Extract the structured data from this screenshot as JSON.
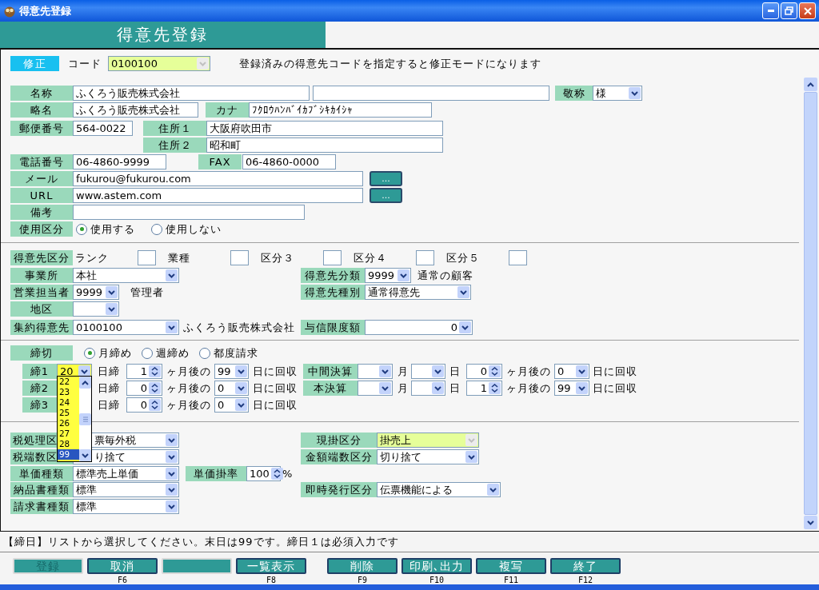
{
  "window": {
    "title": "得意先登録"
  },
  "header": {
    "title": "得意先登録"
  },
  "mode": {
    "badge": "修正",
    "code_label": "コード",
    "code": {
      "value": "0100100",
      "disabled": true
    },
    "hint": "登録済みの得意先コードを指定すると修正モードになります"
  },
  "basic": {
    "name": {
      "label": "名称",
      "value": "ふくろう販売株式会社"
    },
    "honorific": {
      "label": "敬称",
      "value": "様"
    },
    "short_name": {
      "label": "略名",
      "value": "ふくろう販売株式会社"
    },
    "kana": {
      "label": "カナ",
      "value": "ﾌｸﾛｳﾊﾝﾊﾞｲｶﾌﾞｼｷｶｲｼｬ"
    },
    "postal": {
      "label": "郵便番号",
      "value": "564-0022"
    },
    "address1": {
      "label": "住所１",
      "value": "大阪府吹田市"
    },
    "address2": {
      "label": "住所２",
      "value": "昭和町"
    },
    "phone": {
      "label": "電話番号",
      "value": "06-4860-9999"
    },
    "fax": {
      "label": "FAX",
      "value": "06-4860-0000"
    },
    "email": {
      "label": "メール",
      "value": "fukurou@fukurou.com",
      "button": "..."
    },
    "url": {
      "label": "URL",
      "value": "www.astem.com",
      "button": "..."
    },
    "note": {
      "label": "備考"
    },
    "usage": {
      "label": "使用区分",
      "options": [
        {
          "label": "使用する",
          "selected": true
        },
        {
          "label": "使用しない",
          "selected": false
        }
      ]
    }
  },
  "classification": {
    "label": "得意先区分",
    "slots": [
      "ランク",
      "業種",
      "区分３",
      "区分４",
      "区分５"
    ]
  },
  "organization": {
    "office": {
      "label": "事業所",
      "value": "本社"
    },
    "sales_rep": {
      "label": "営業担当者",
      "value": "9999",
      "name": "管理者"
    },
    "area": {
      "label": "地区"
    },
    "parent_customer": {
      "label": "集約得意先",
      "value": "0100100",
      "name": "ふくろう販売株式会社"
    },
    "category": {
      "label": "得意先分類",
      "value": "9999",
      "name": "通常の顧客"
    },
    "customer_type": {
      "label": "得意先種別",
      "value": "通常得意先"
    },
    "credit_limit": {
      "label": "与信限度額",
      "value": "0"
    }
  },
  "closing": {
    "label": "締切",
    "options": [
      {
        "label": "月締め",
        "selected": true
      },
      {
        "label": "週締め",
        "selected": false
      },
      {
        "label": "都度請求",
        "selected": false
      }
    ],
    "rows": [
      {
        "label": "締1",
        "day": "20",
        "focused": true,
        "day_unit": "日締",
        "months": "1",
        "after": "ヶ月後の",
        "pay_day": "99",
        "collect": "日に回収"
      },
      {
        "label": "締2",
        "day_unit": "日締",
        "months": "0",
        "after": "ヶ月後の",
        "pay_day": "0",
        "collect": "日に回収"
      },
      {
        "label": "締3",
        "day_unit": "日締",
        "months": "0",
        "after": "ヶ月後の",
        "pay_day": "0",
        "collect": "日に回収"
      }
    ],
    "settlements": [
      {
        "label": "中間決算",
        "month_unit": "月",
        "day_unit": "日",
        "months": "0",
        "after": "ヶ月後の",
        "pay_day": "0",
        "collect": "日に回収"
      },
      {
        "label": "本決算",
        "month_unit": "月",
        "day_unit": "日",
        "months": "1",
        "after": "ヶ月後の",
        "pay_day": "99",
        "collect": "日に回収"
      }
    ],
    "dropdown": {
      "items": [
        {
          "label": "22",
          "selected": false
        },
        {
          "label": "23",
          "selected": false
        },
        {
          "label": "24",
          "selected": false
        },
        {
          "label": "25",
          "selected": false
        },
        {
          "label": "26",
          "selected": false
        },
        {
          "label": "27",
          "selected": false
        },
        {
          "label": "28",
          "selected": false
        },
        {
          "label": "99",
          "selected": true
        }
      ]
    }
  },
  "terms": [
    {
      "left": {
        "label": "税処理区",
        "value": "票毎外税",
        "covered": true
      },
      "right": {
        "label": "現掛区分",
        "value": "掛売上",
        "disabled": true
      }
    },
    {
      "left": {
        "label": "税端数区",
        "value": "り捨て",
        "covered": true
      },
      "right": {
        "label": "金額端数区分",
        "value": "切り捨て",
        "disabled": false
      }
    },
    {
      "left": {
        "label": "単価種類",
        "value": "標準売上単価",
        "covered": false
      },
      "rate": {
        "label": "単価掛率",
        "value": "100",
        "unit": "%"
      }
    },
    {
      "left": {
        "label": "納品書種類",
        "value": "標準",
        "covered": false
      },
      "right": {
        "label": "即時発行区分",
        "value": "伝票機能による",
        "disabled": false
      }
    },
    {
      "left": {
        "label": "請求書種類",
        "value": "標準",
        "covered": false
      }
    }
  ],
  "status_message": "【締日】リストから選択してください。末日は99です。締日１は必須入力です",
  "function_keys": [
    [
      {
        "label": "登録",
        "disabled": true
      },
      {
        "label": "取消",
        "key": "F6",
        "disabled": false
      },
      {
        "disabled": true
      },
      {
        "label": "一覧表示",
        "key": "F8",
        "disabled": false
      }
    ],
    [
      {
        "label": "削除",
        "key": "F9",
        "disabled": false
      },
      {
        "label": "印刷､出力",
        "key": "F10",
        "disabled": false
      },
      {
        "label": "複写",
        "key": "F11",
        "disabled": false
      },
      {
        "label": "終了",
        "key": "F12",
        "disabled": false
      }
    ]
  ]
}
